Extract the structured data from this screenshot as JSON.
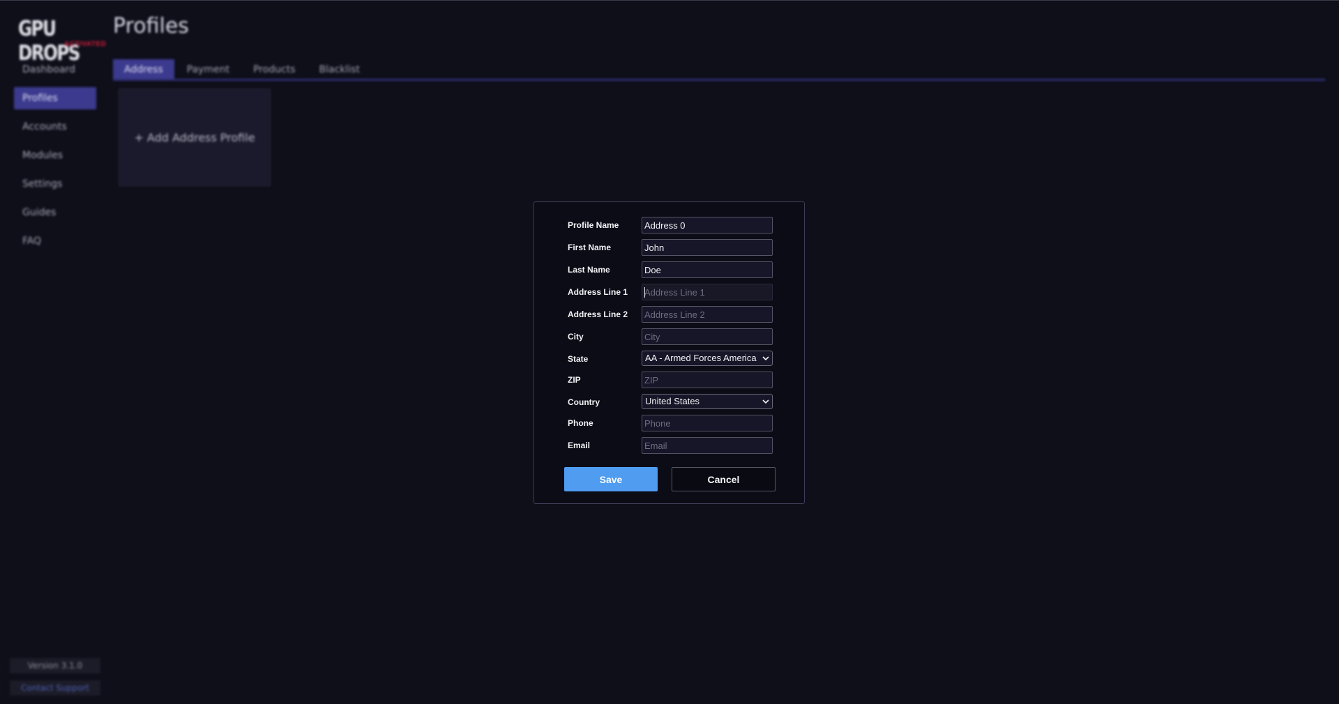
{
  "logo": {
    "main": "GPU DROPS",
    "sub": "ACTIVATED"
  },
  "page": {
    "title": "Profiles"
  },
  "sidebar": {
    "items": [
      {
        "label": "Dashboard",
        "active": false
      },
      {
        "label": "Profiles",
        "active": true
      },
      {
        "label": "Accounts",
        "active": false
      },
      {
        "label": "Modules",
        "active": false
      },
      {
        "label": "Settings",
        "active": false
      },
      {
        "label": "Guides",
        "active": false
      },
      {
        "label": "FAQ",
        "active": false
      }
    ],
    "version": "Version 3.1.0",
    "support": "Contact Support"
  },
  "tabs": [
    {
      "label": "Address",
      "active": true
    },
    {
      "label": "Payment",
      "active": false
    },
    {
      "label": "Products",
      "active": false
    },
    {
      "label": "Blacklist",
      "active": false
    }
  ],
  "add_card": {
    "label": "+ Add Address Profile"
  },
  "form": {
    "profile_name": {
      "label": "Profile Name",
      "value": "Address 0",
      "placeholder": "Profile Name"
    },
    "first_name": {
      "label": "First Name",
      "value": "John",
      "placeholder": "First Name"
    },
    "last_name": {
      "label": "Last Name",
      "value": "Doe",
      "placeholder": "Last Name"
    },
    "address1": {
      "label": "Address Line 1",
      "value": "",
      "placeholder": "Address Line 1"
    },
    "address2": {
      "label": "Address Line 2",
      "value": "",
      "placeholder": "Address Line 2"
    },
    "city": {
      "label": "City",
      "value": "",
      "placeholder": "City"
    },
    "state": {
      "label": "State",
      "selected": "AA - Armed Forces America"
    },
    "zip": {
      "label": "ZIP",
      "value": "",
      "placeholder": "ZIP"
    },
    "country": {
      "label": "Country",
      "selected": "United States"
    },
    "phone": {
      "label": "Phone",
      "value": "",
      "placeholder": "Phone"
    },
    "email": {
      "label": "Email",
      "value": "",
      "placeholder": "Email"
    },
    "save_label": "Save",
    "cancel_label": "Cancel"
  },
  "colors": {
    "background": "#0f0f1a",
    "accent": "#3b3a8e",
    "save_button": "#4f9cf0",
    "logo_sub": "#d81d3a"
  }
}
